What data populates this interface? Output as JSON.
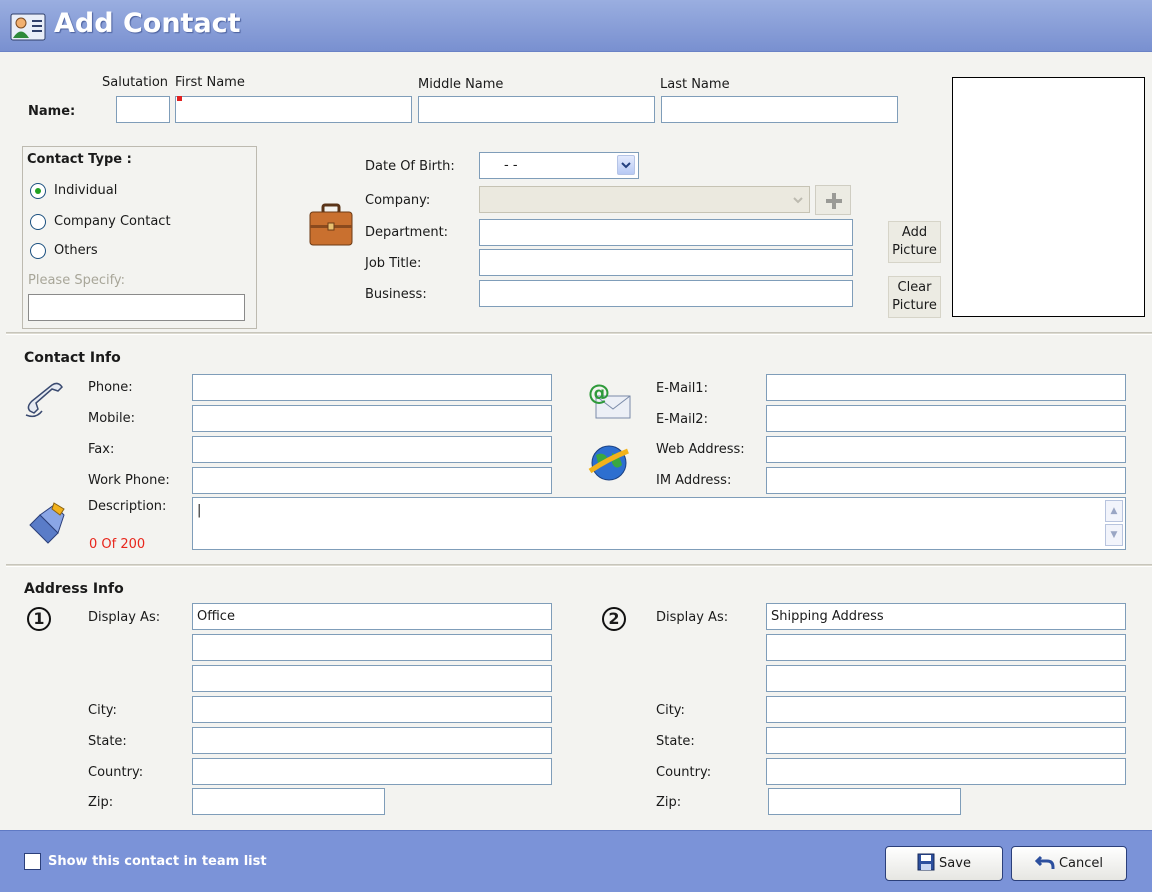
{
  "window": {
    "title": "Add Contact"
  },
  "name": {
    "label": "Name:",
    "salutation_label": "Salutation",
    "first_name_label": "First Name",
    "middle_name_label": "Middle Name",
    "last_name_label": "Last Name",
    "salutation": "",
    "first_name": "",
    "middle_name": "",
    "last_name": ""
  },
  "contact_type": {
    "title": "Contact Type :",
    "options": [
      "Individual",
      "Company Contact",
      "Others"
    ],
    "selected": "Individual",
    "specify_label": "Please Specify:",
    "specify_value": ""
  },
  "details": {
    "dob_label": "Date Of Birth:",
    "dob_value": "- -",
    "company_label": "Company:",
    "company_value": "",
    "department_label": "Department:",
    "job_title_label": "Job Title:",
    "business_label": "Business:"
  },
  "picture": {
    "add_label_1": "Add",
    "add_label_2": "Picture",
    "clear_label_1": "Clear",
    "clear_label_2": "Picture"
  },
  "contact_info": {
    "title": "Contact Info",
    "phone_label": "Phone:",
    "mobile_label": "Mobile:",
    "fax_label": "Fax:",
    "work_phone_label": "Work Phone:",
    "email1_label": "E-Mail1:",
    "email2_label": "E-Mail2:",
    "web_label": "Web Address:",
    "im_label": "IM Address:",
    "description_label": "Description:",
    "char_count": "0 Of 200",
    "description_value": "|"
  },
  "address_info": {
    "title": "Address Info",
    "addresses": [
      {
        "number": "1",
        "display_as_label": "Display As:",
        "display_as": "Office",
        "city_label": "City:",
        "state_label": "State:",
        "country_label": "Country:",
        "zip_label": "Zip:"
      },
      {
        "number": "2",
        "display_as_label": "Display As:",
        "display_as": "Shipping Address",
        "city_label": "City:",
        "state_label": "State:",
        "country_label": "Country:",
        "zip_label": "Zip:"
      }
    ]
  },
  "footer": {
    "team_list_label": "Show this contact in team list",
    "save_label": "Save",
    "cancel_label": "Cancel"
  },
  "icons": [
    "contact-card-icon",
    "briefcase-icon",
    "phone-icon",
    "email-icon",
    "globe-icon",
    "pencil-icon",
    "plus-icon",
    "save-disk-icon",
    "undo-icon"
  ],
  "colors": {
    "titlebar": "#7990d0",
    "footer": "#7b93d8",
    "input_border": "#7f9db9",
    "count_text": "#e8261c"
  }
}
